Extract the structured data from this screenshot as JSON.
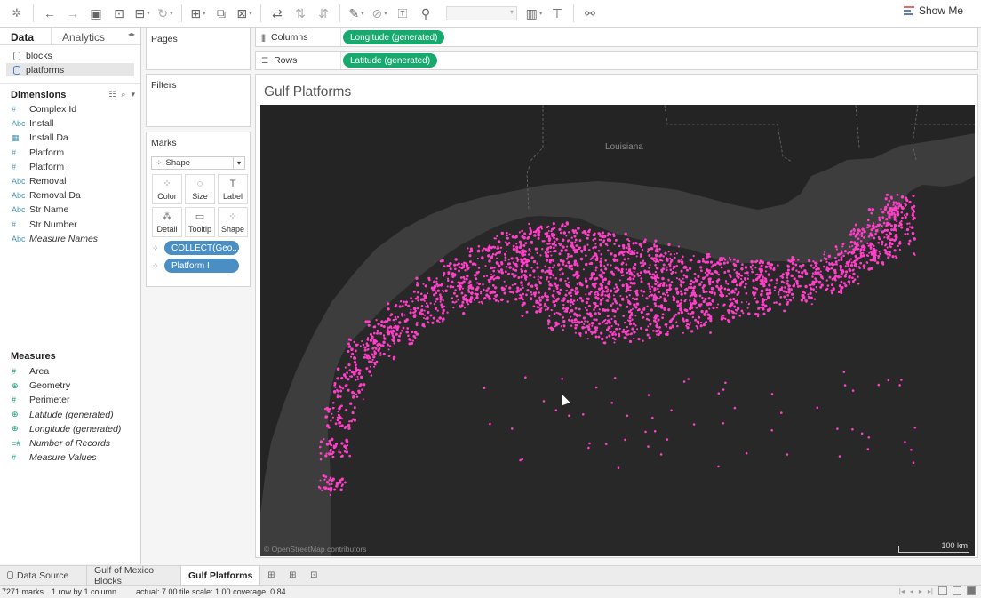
{
  "toolbar": {
    "show_me_label": "Show Me",
    "icons": [
      "tableau-logo-icon",
      "undo-icon",
      "redo-icon",
      "save-icon",
      "new-data-source-icon",
      "pause-updates-icon",
      "refresh-icon",
      "new-worksheet-icon",
      "duplicate-sheet-icon",
      "clear-sheet-icon",
      "swap-icon",
      "sort-ascending-icon",
      "sort-descending-icon",
      "highlight-icon",
      "group-icon",
      "label-icon",
      "fix-axes-icon",
      "show-cards-icon",
      "presentation-icon",
      "share-icon"
    ],
    "show_me_colors": [
      "#e06c6c",
      "#5b7fc7",
      "#5b7fc7"
    ]
  },
  "data_pane": {
    "tabs": {
      "data": "Data",
      "analytics": "Analytics"
    },
    "data_sources": [
      "blocks",
      "platforms"
    ],
    "dimensions_header": "Dimensions",
    "dimensions": [
      {
        "icon": "#",
        "label": "Complex Id",
        "italic": false
      },
      {
        "icon": "Abc",
        "label": "Install",
        "italic": false
      },
      {
        "icon": "▦",
        "label": "Install Da",
        "italic": false
      },
      {
        "icon": "#",
        "label": "Platform",
        "italic": false
      },
      {
        "icon": "#",
        "label": "Platform I",
        "italic": false
      },
      {
        "icon": "Abc",
        "label": "Removal",
        "italic": false
      },
      {
        "icon": "Abc",
        "label": "Removal Da",
        "italic": false
      },
      {
        "icon": "Abc",
        "label": "Str Name",
        "italic": false
      },
      {
        "icon": "#",
        "label": "Str Number",
        "italic": false
      },
      {
        "icon": "Abc",
        "label": "Measure Names",
        "italic": true
      }
    ],
    "measures_header": "Measures",
    "measures": [
      {
        "icon": "#",
        "label": "Area",
        "italic": false
      },
      {
        "icon": "⊕",
        "label": "Geometry",
        "italic": false
      },
      {
        "icon": "#",
        "label": "Perimeter",
        "italic": false
      },
      {
        "icon": "⊕",
        "label": "Latitude (generated)",
        "italic": true
      },
      {
        "icon": "⊕",
        "label": "Longitude (generated)",
        "italic": true
      },
      {
        "icon": "=#",
        "label": "Number of Records",
        "italic": true
      },
      {
        "icon": "#",
        "label": "Measure Values",
        "italic": true
      }
    ]
  },
  "cards": {
    "pages": "Pages",
    "filters": "Filters",
    "marks": "Marks",
    "mark_type": "Shape",
    "mark_buttons": [
      {
        "icon": "⁘",
        "label": "Color"
      },
      {
        "icon": "◌",
        "label": "Size"
      },
      {
        "icon": "T",
        "label": "Label"
      },
      {
        "icon": "⁂",
        "label": "Detail"
      },
      {
        "icon": "▭",
        "label": "Tooltip"
      },
      {
        "icon": "⁘",
        "label": "Shape"
      }
    ],
    "mark_pills": [
      "COLLECT(Geo...",
      "Platform I"
    ]
  },
  "shelves": {
    "columns_label": "Columns",
    "columns_pill": "Longitude (generated)",
    "rows_label": "Rows",
    "rows_pill": "Latitude (generated)"
  },
  "viz": {
    "title": "Gulf Platforms",
    "map_label": "Louisiana",
    "attribution": "© OpenStreetMap contributors",
    "scale_label": "100 km",
    "mark_color": "#ff3fc8",
    "land_color": "#3d3d3d",
    "water_color": "#282828"
  },
  "sheet_tabs": {
    "data_source": "Data Source",
    "tabs": [
      "Gulf of Mexico Blocks",
      "Gulf Platforms"
    ],
    "active": "Gulf Platforms"
  },
  "status": {
    "marks": "7271 marks",
    "layout": "1 row by 1 column",
    "scale_info": "actual: 7.00 tile scale: 1.00 coverage: 0.84"
  }
}
